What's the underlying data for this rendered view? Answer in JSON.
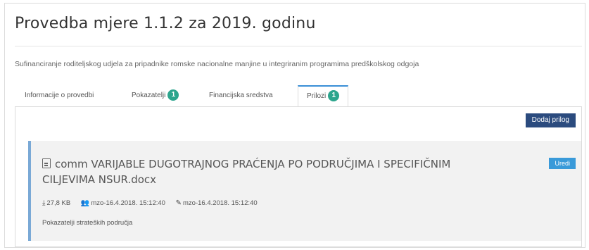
{
  "page": {
    "title": "Provedba mjere 1.1.2 za 2019. godinu",
    "subtitle": "Sufinanciranje roditeljskog udjela za pripadnike romske nacionalne manjine u integriranim programima predškolskog odgoja"
  },
  "tabs": [
    {
      "label": "Informacije o provedbi",
      "badge": ""
    },
    {
      "label": "Pokazatelji",
      "badge": "1"
    },
    {
      "label": "Financijska sredstva",
      "badge": ""
    },
    {
      "label": "Prilozi",
      "badge": "1"
    }
  ],
  "toolbar": {
    "add_label": "Dodaj prilog"
  },
  "attachment": {
    "icon": "document-icon",
    "filename": "comm VARIJABLE DUGOTRAJNOG PRAĆENJA PO PODRUČJIMA I SPECIFIČNIM CILJEVIMA NSUR.docx",
    "edit_label": "Uredi",
    "size": "27,8 KB",
    "uploaded_by": "mzo-16.4.2018. 15:12:40",
    "edited_by": "mzo-16.4.2018. 15:12:40",
    "description": "Pokazatelji strateških područja"
  },
  "colors": {
    "badge": "#2ca58d",
    "add_button": "#2b4b7e",
    "edit_button": "#3a9ad9",
    "active_tab": "#3a8fd6"
  }
}
